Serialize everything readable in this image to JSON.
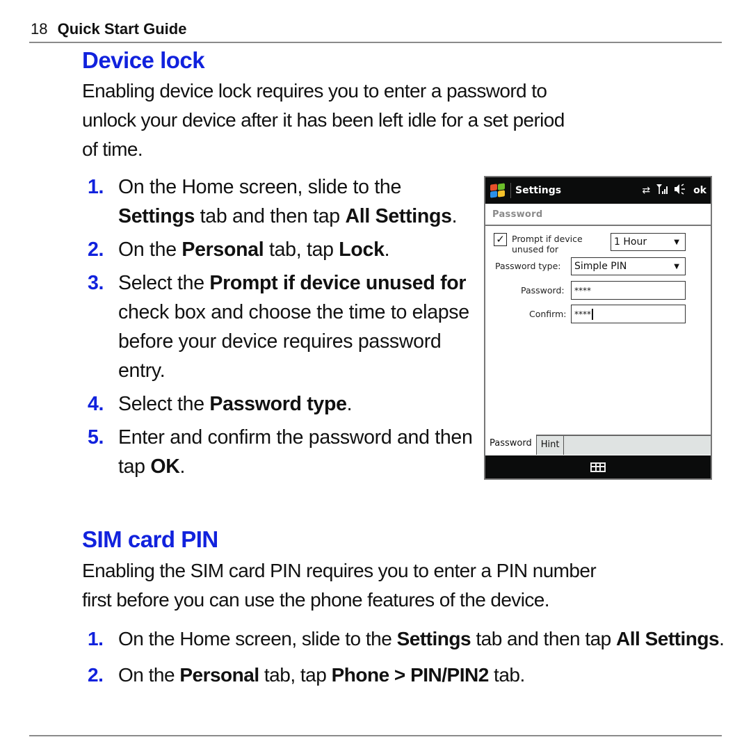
{
  "header": {
    "page_number": "18",
    "guide_title": "Quick Start Guide"
  },
  "device_lock": {
    "title": "Device lock",
    "intro_lines": [
      "Enabling device lock requires you to enter a password to",
      "unlock your device after it has been left idle for a set period",
      "of time."
    ],
    "steps": [
      {
        "num": "1.",
        "parts": [
          "On the Home screen, slide to the ",
          {
            "b": "Settings"
          },
          " tab and then tap ",
          {
            "b": "All Settings"
          },
          "."
        ]
      },
      {
        "num": "2.",
        "parts": [
          "On the ",
          {
            "b": "Personal"
          },
          " tab, tap ",
          {
            "b": "Lock"
          },
          "."
        ]
      },
      {
        "num": "3.",
        "parts": [
          "Select the ",
          {
            "b": "Prompt if device unused for"
          },
          " check box and choose the time to elapse before your device requires password entry."
        ]
      },
      {
        "num": "4.",
        "parts": [
          "Select the ",
          {
            "b": "Password type"
          },
          "."
        ]
      },
      {
        "num": "5.",
        "parts": [
          "Enter and confirm the password and then tap ",
          {
            "b": "OK"
          },
          "."
        ]
      }
    ]
  },
  "phone_screen": {
    "title": "Settings",
    "status_icons": [
      "sync-icon",
      "signal-icon",
      "speaker-icon"
    ],
    "ok_label": "ok",
    "subheader": "Password",
    "prompt_checkbox": {
      "checked": true,
      "label_line1": "Prompt if device",
      "label_line2": "unused for"
    },
    "timeout_select": {
      "value": "1 Hour"
    },
    "password_type": {
      "label": "Password type:",
      "value": "Simple PIN"
    },
    "password": {
      "label": "Password:",
      "value": "****"
    },
    "confirm": {
      "label": "Confirm:",
      "value": "****"
    },
    "tabs": [
      "Password",
      "Hint"
    ],
    "active_tab": "Password",
    "softbar_icon": "keyboard-icon"
  },
  "sim_pin": {
    "title": "SIM card PIN",
    "intro_lines": [
      "Enabling the SIM card PIN requires you to enter a PIN number",
      "first before you can use the phone features of the device."
    ],
    "steps": [
      {
        "num": "1.",
        "parts": [
          "On the Home screen, slide to the ",
          {
            "b": "Settings"
          },
          " tab and then tap ",
          {
            "b": "All Settings"
          },
          "."
        ]
      },
      {
        "num": "2.",
        "parts": [
          "On the ",
          {
            "b": "Personal"
          },
          " tab, tap ",
          {
            "b": "Phone > PIN/PIN2"
          },
          " tab."
        ]
      }
    ]
  },
  "colors": {
    "heading_blue": "#1122dd",
    "step_number_blue": "#1122dd",
    "rule_gray": "#8a8a8a",
    "phone_titlebar": "#0b0c0c"
  }
}
